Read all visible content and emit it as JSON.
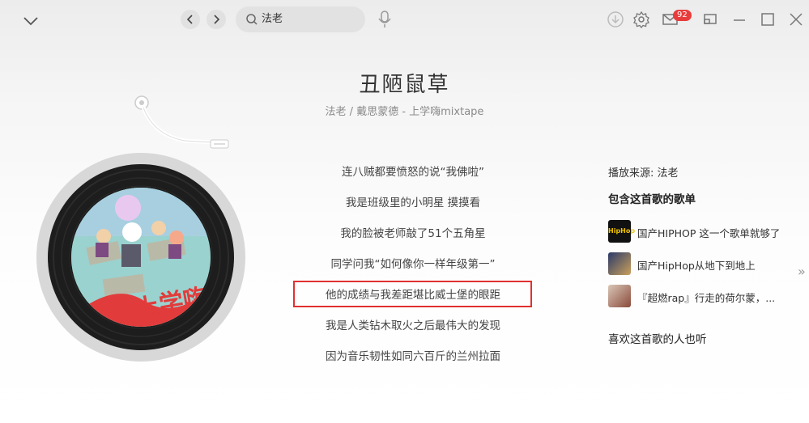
{
  "search": {
    "value": "法老"
  },
  "header": {
    "mail_badge": "92"
  },
  "song": {
    "title": "丑陋鼠草",
    "subtitle": "法老 / 戴思蒙德 - 上学嗨mixtape"
  },
  "lyrics": [
    "连八贼都要愤怒的说“我佛啦”",
    "我是班级里的小明星 摸摸看",
    "我的脸被老师敲了51个五角星",
    "同学问我“如何像你一样年级第一”",
    "他的成绩与我差距堪比威士堡的眼距",
    "我是人类钻木取火之后最伟大的发现",
    "因为音乐韧性如同六百斤的兰州拉面"
  ],
  "active_lyric_index": 4,
  "sidebar": {
    "source_label": "播放来源: 法老",
    "playlists_heading": "包含这首歌的歌单",
    "playlists": [
      {
        "title": "国产HIPHOP 这一个歌单就够了",
        "thumb_text": "HipHop"
      },
      {
        "title": "国产HipHop从地下到地上"
      },
      {
        "title": "『超燃rap』行走的荷尔蒙，..."
      }
    ],
    "also_listen_heading": "喜欢这首歌的人也听"
  },
  "album_art": {
    "text": "上学嗨"
  },
  "colors": {
    "accent_red": "#e23030",
    "badge_red": "#e83c3c"
  }
}
